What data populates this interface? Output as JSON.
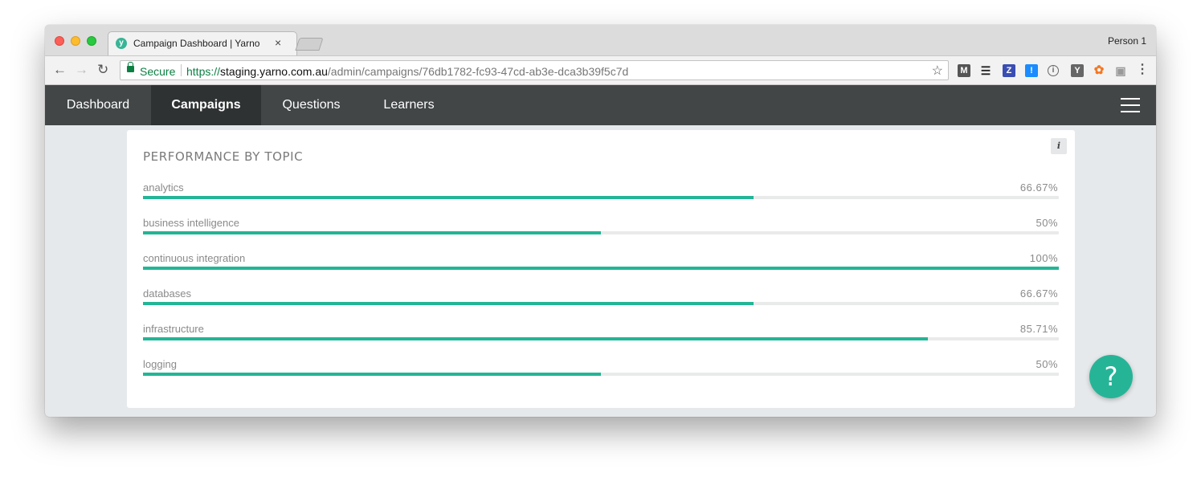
{
  "browser": {
    "tab_title": "Campaign Dashboard | Yarno",
    "tab_favicon_letter": "y",
    "tab_close": "×",
    "profile_name": "Person 1",
    "secure_label": "Secure",
    "url_scheme": "https://",
    "url_host": "staging.yarno.com.au",
    "url_path": "/admin/campaigns/76db1782-fc93-47cd-ab3e-dca3b39f5c7d",
    "extensions": {
      "m": "M",
      "z": "Z",
      "bang": "!",
      "circle": "i",
      "y": "Y"
    }
  },
  "nav": {
    "items": [
      {
        "label": "Dashboard",
        "active": false
      },
      {
        "label": "Campaigns",
        "active": true
      },
      {
        "label": "Questions",
        "active": false
      },
      {
        "label": "Learners",
        "active": false
      }
    ]
  },
  "card": {
    "title": "PERFORMANCE BY TOPIC",
    "info_label": "i",
    "topics": [
      {
        "label": "analytics",
        "value_text": "66.67%",
        "percent": 66.67
      },
      {
        "label": "business intelligence",
        "value_text": "50%",
        "percent": 50
      },
      {
        "label": "continuous integration",
        "value_text": "100%",
        "percent": 100
      },
      {
        "label": "databases",
        "value_text": "66.67%",
        "percent": 66.67
      },
      {
        "label": "infrastructure",
        "value_text": "85.71%",
        "percent": 85.71
      },
      {
        "label": "logging",
        "value_text": "50%",
        "percent": 50
      }
    ]
  },
  "help": {
    "label": "?"
  },
  "colors": {
    "accent": "#23b596",
    "nav_bg": "#424647",
    "nav_active_bg": "#2f3233"
  }
}
